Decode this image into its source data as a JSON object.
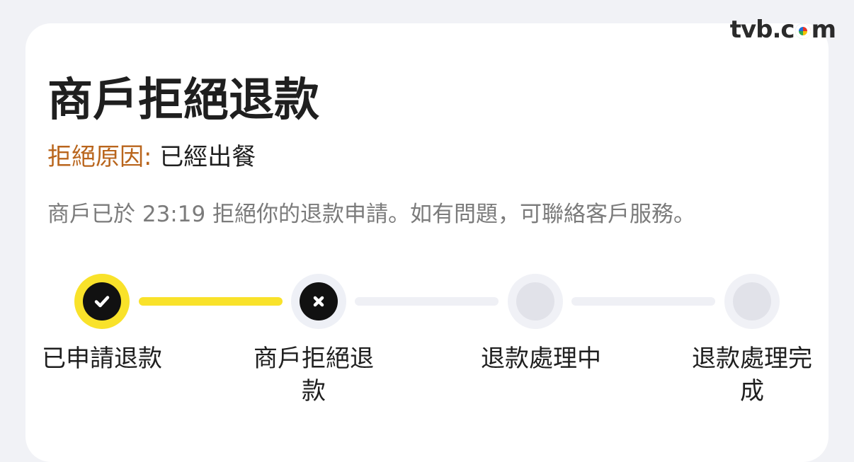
{
  "watermark": {
    "left": "tvb.c",
    "right": "m"
  },
  "header": {
    "title": "商戶拒絕退款"
  },
  "reason": {
    "label": "拒絕原因:",
    "value": "已經出餐"
  },
  "description": "商戶已於 23:19 拒絕你的退款申請。如有問題，可聯絡客戶服務。",
  "steps": [
    {
      "label": "已申請退款",
      "status": "done",
      "icon": "check-icon"
    },
    {
      "label": "商戶拒絕退款",
      "status": "rejected",
      "icon": "x-icon"
    },
    {
      "label": "退款處理中",
      "status": "pending",
      "icon": "empty-circle"
    },
    {
      "label": "退款處理完成",
      "status": "pending",
      "icon": "empty-circle"
    }
  ],
  "colors": {
    "accent": "#f9e22a",
    "reason_label": "#b9651c",
    "text": "#1f1f1f",
    "muted": "#7b7b7b"
  }
}
